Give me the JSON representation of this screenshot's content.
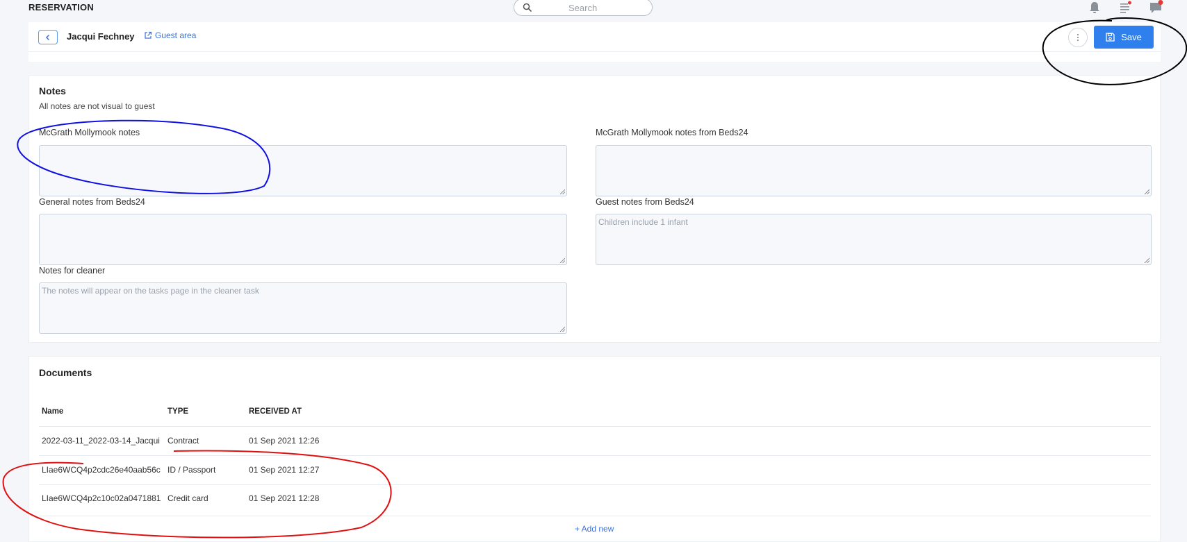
{
  "app": {
    "title": "RESERVATION"
  },
  "search": {
    "placeholder": "Search"
  },
  "header": {
    "guest_name": "Jacqui Fechney",
    "guest_area_label": "Guest area",
    "save_label": "Save"
  },
  "notes": {
    "title": "Notes",
    "subtitle": "All notes are not visual to guest",
    "fields": [
      {
        "label": "McGrath Mollymook notes",
        "value": "",
        "placeholder": ""
      },
      {
        "label": "McGrath Mollymook notes from Beds24",
        "value": "",
        "placeholder": ""
      },
      {
        "label": "General notes from Beds24",
        "value": "",
        "placeholder": ""
      },
      {
        "label": "Guest notes from Beds24",
        "value": "Children include 1 infant",
        "placeholder": ""
      },
      {
        "label": "Notes for cleaner",
        "value": "",
        "placeholder": "The notes will appear on the tasks page in the cleaner task"
      }
    ]
  },
  "documents": {
    "title": "Documents",
    "columns": [
      "Name",
      "TYPE",
      "RECEIVED AT"
    ],
    "rows": [
      {
        "name": "2022-03-11_2022-03-14_Jacqui",
        "type": "Contract",
        "received_at": "01 Sep 2021 12:26"
      },
      {
        "name": "LIae6WCQ4p2cdc26e40aab56c",
        "type": "ID / Passport",
        "received_at": "01 Sep 2021 12:27"
      },
      {
        "name": "LIae6WCQ4p2c10c02a0471881",
        "type": "Credit card",
        "received_at": "01 Sep 2021 12:28"
      }
    ],
    "add_new_label": "+ Add new"
  },
  "colors": {
    "accent": "#2f80ed",
    "annotation_black": "#000000",
    "annotation_blue": "#1010e0",
    "annotation_red": "#e01010"
  }
}
